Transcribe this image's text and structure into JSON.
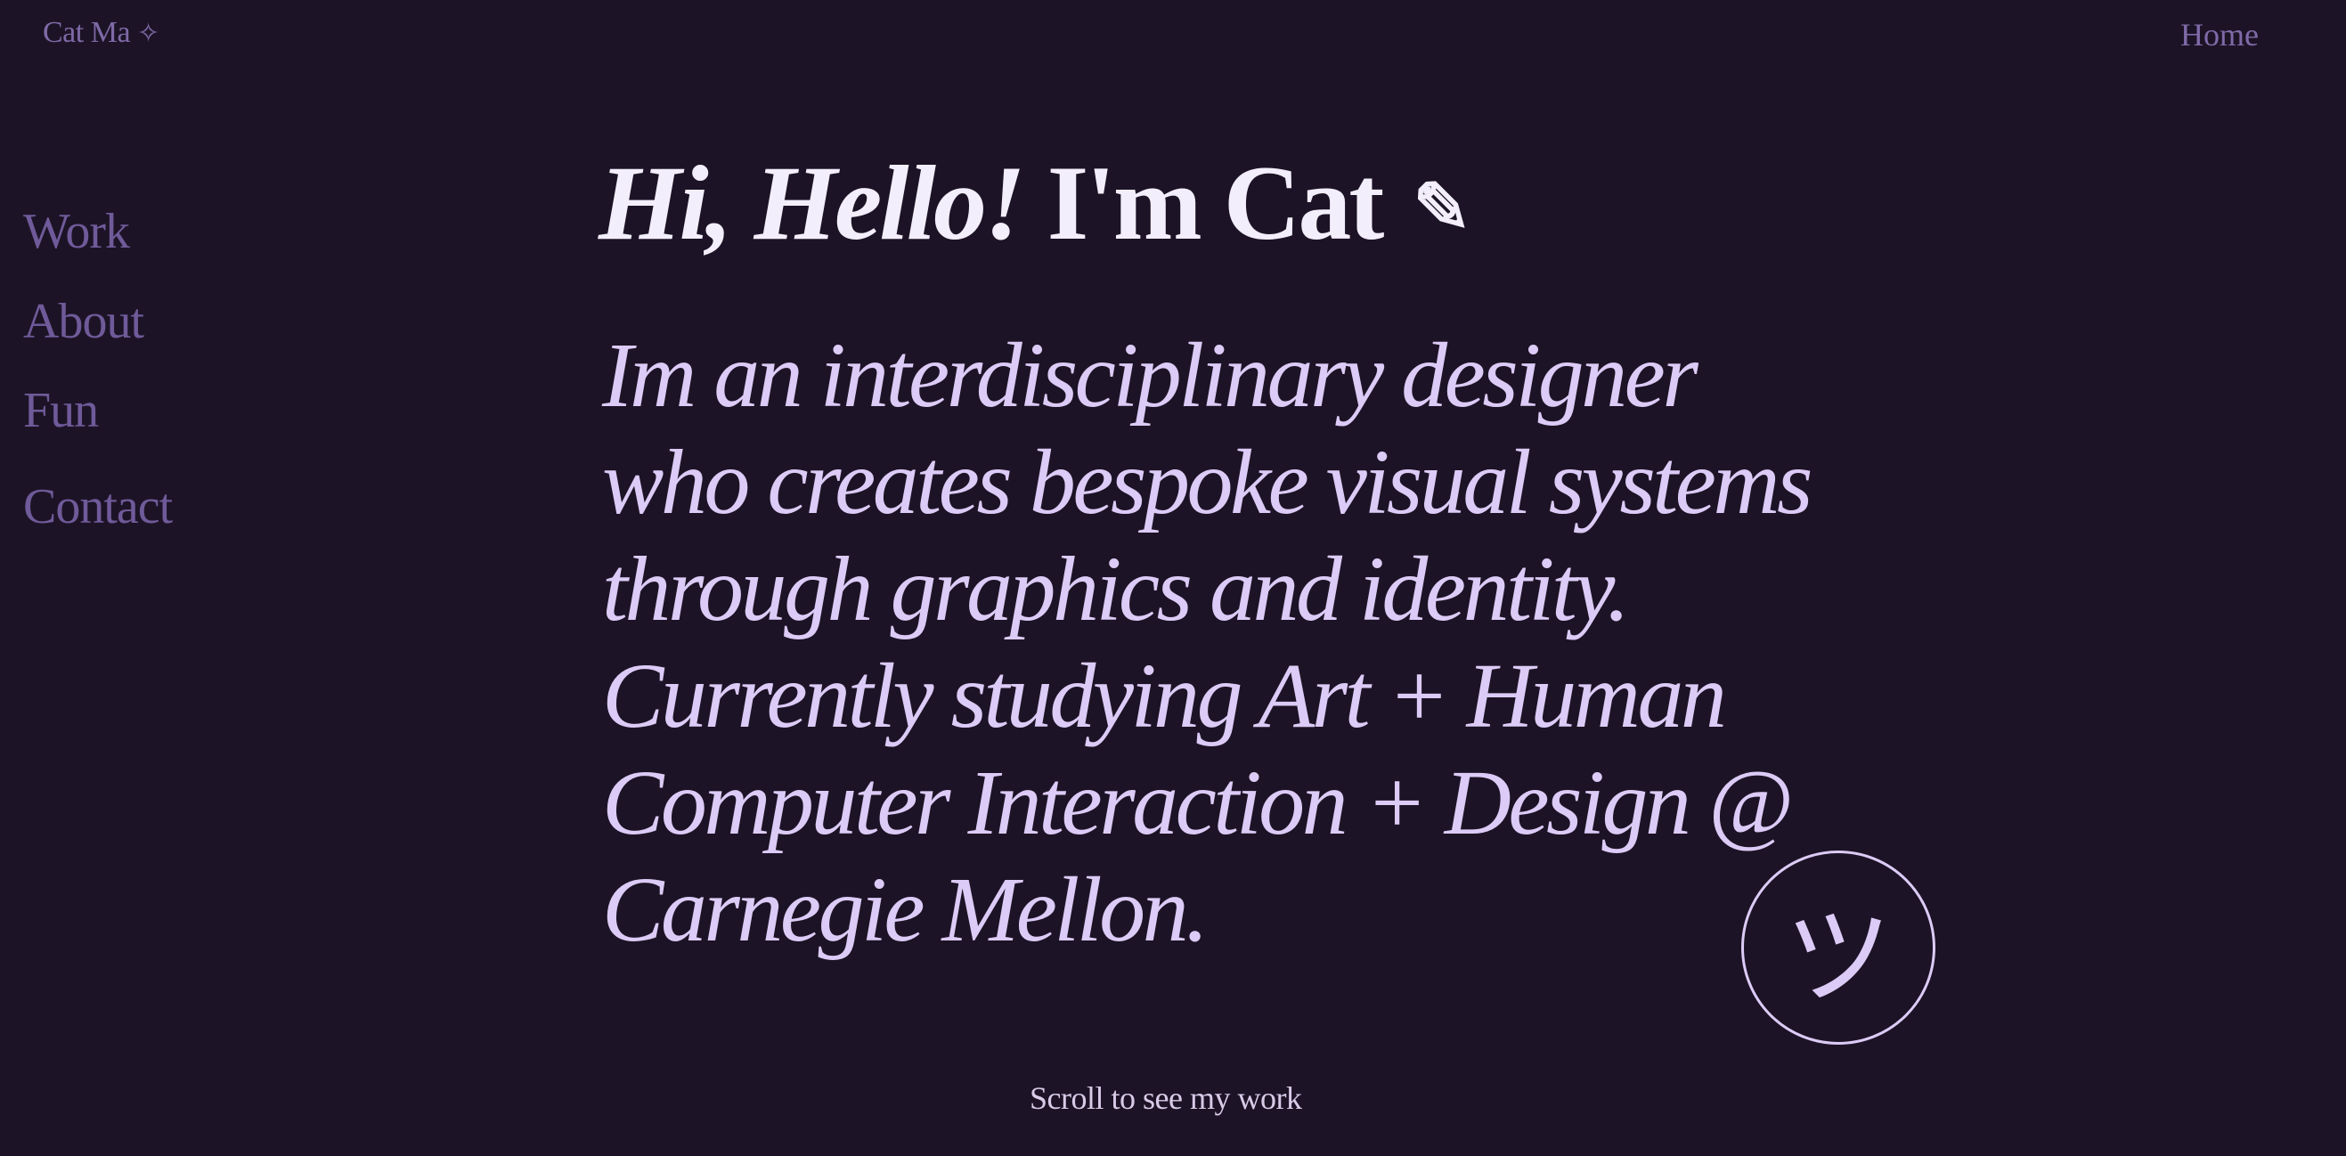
{
  "header": {
    "brand_name": "Cat Ma",
    "brand_icon": "✧",
    "home_label": "Home"
  },
  "sidebar": {
    "items": [
      {
        "label": "Work"
      },
      {
        "label": "About"
      },
      {
        "label": "Fun"
      },
      {
        "label": "Contact"
      }
    ]
  },
  "hero": {
    "greeting": "Hi, Hello!",
    "name_text": " I'm Cat",
    "pencil_icon": "✎",
    "intro_lines": [
      "Im an interdisciplinary designer",
      "who creates bespoke visual systems",
      "through graphics and identity.",
      "Currently studying Art + Human",
      "Computer Interaction + Design @",
      "Carnegie Mellon."
    ],
    "smiley_glyph": "ツ"
  },
  "footer": {
    "scroll_hint": "Scroll to see my work"
  },
  "colors": {
    "background": "#1c1426",
    "nav": "#6f5a9a",
    "heading": "#f3eefb",
    "intro": "#dccbf6"
  }
}
